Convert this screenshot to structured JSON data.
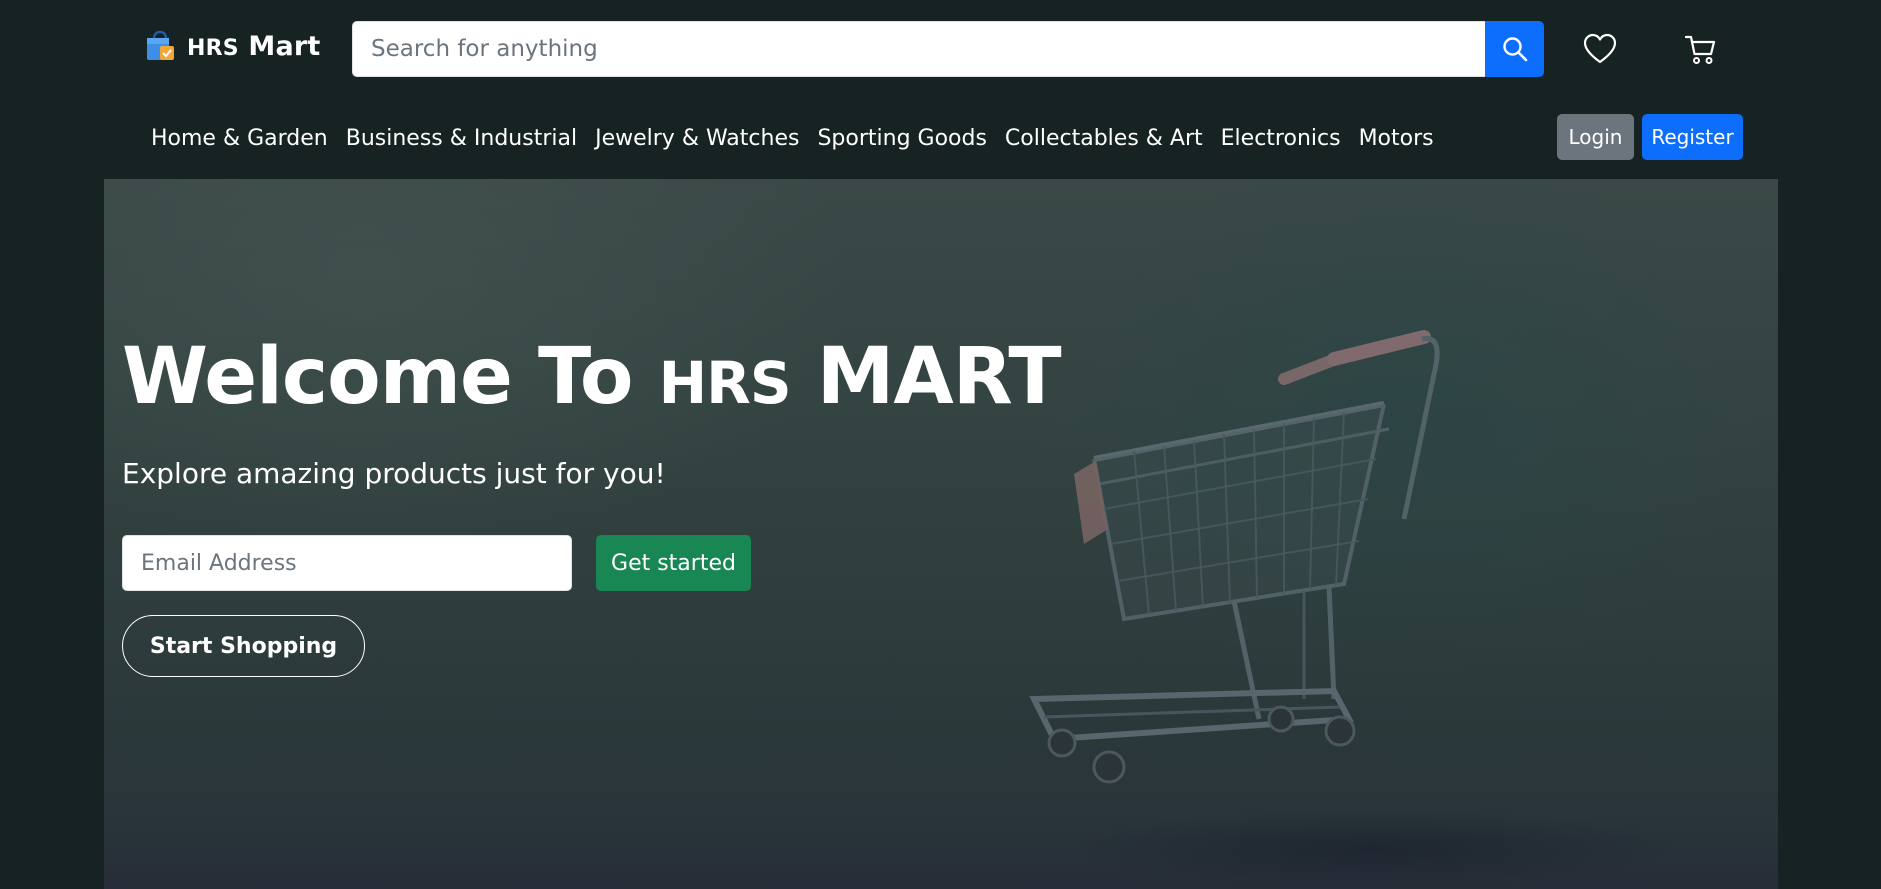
{
  "header": {
    "brand": {
      "prefix": "HRS",
      "name": "Mart"
    },
    "search": {
      "placeholder": "Search for anything"
    }
  },
  "icons": {
    "logo": "shopping-bag-icon",
    "search": "search-icon",
    "wishlist": "heart-icon",
    "cart": "cart-icon"
  },
  "nav": {
    "items": [
      {
        "label": "Home & Garden"
      },
      {
        "label": "Business & Industrial"
      },
      {
        "label": "Jewelry & Watches"
      },
      {
        "label": "Sporting Goods"
      },
      {
        "label": "Collectables & Art"
      },
      {
        "label": "Electronics"
      },
      {
        "label": "Motors"
      }
    ]
  },
  "auth": {
    "login_label": "Login",
    "register_label": "Register"
  },
  "hero": {
    "title_start": "Welcome To",
    "title_brand": "HRS",
    "title_end": "MART",
    "subtitle": "Explore amazing products just for you!",
    "email_placeholder": "Email Address",
    "get_started_label": "Get started",
    "start_shopping_label": "Start Shopping"
  },
  "colors": {
    "page_bg": "#172222",
    "primary": "#0d6efd",
    "success": "#198754",
    "secondary": "#6c757d"
  }
}
